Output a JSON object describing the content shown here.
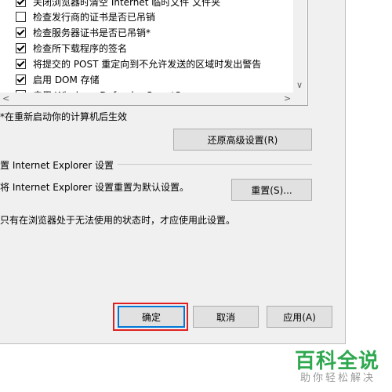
{
  "settings_list": {
    "items": [
      {
        "label": "关闭浏览器时清空 Internet 临时文件 文件夹",
        "checked": true
      },
      {
        "label": "检查发行商的证书是否已吊销",
        "checked": false
      },
      {
        "label": "检查服务器证书是否已吊销*",
        "checked": true
      },
      {
        "label": "检查所下载程序的签名",
        "checked": true
      },
      {
        "label": "将提交的 POST 重定向到不允许发送的区域时发出警告",
        "checked": true
      },
      {
        "label": "启用 DOM 存储",
        "checked": true
      },
      {
        "label": "启用 Windows Defender SmartScreen",
        "checked": true
      }
    ]
  },
  "restart_note": "*在重新启动你的计算机后生效",
  "restore_button": "还原高级设置(R)",
  "reset_section": {
    "title": "置 Internet Explorer 设置",
    "description": "将 Internet Explorer 设置重置为默认设置。",
    "reset_button": "重置(S)...",
    "warning": "只有在浏览器处于无法使用的状态时，才应使用此设置。"
  },
  "footer": {
    "ok": "确定",
    "cancel": "取消",
    "apply": "应用(A)"
  },
  "watermark": {
    "title": "百科全说",
    "subtitle": "助你轻松解决"
  },
  "colors": {
    "highlight": "#e02020",
    "watermark_green": "#2fa84f"
  }
}
